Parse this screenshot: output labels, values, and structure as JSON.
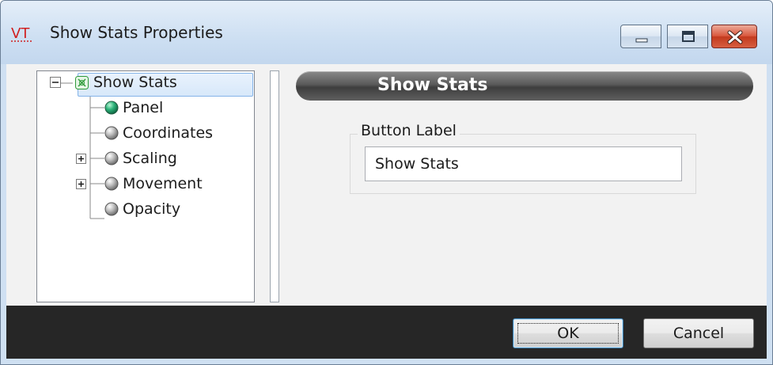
{
  "window": {
    "app_icon_text": "VT",
    "title": "Show Stats Properties"
  },
  "tree": {
    "root": {
      "label": "Show Stats",
      "expanded": true,
      "icon": "show-stats-icon"
    },
    "children": [
      {
        "label": "Panel",
        "icon": "green-sphere-icon",
        "expandable": false
      },
      {
        "label": "Coordinates",
        "icon": "gray-sphere-icon",
        "expandable": false
      },
      {
        "label": "Scaling",
        "icon": "gray-sphere-icon",
        "expandable": true
      },
      {
        "label": "Movement",
        "icon": "gray-sphere-icon",
        "expandable": true
      },
      {
        "label": "Opacity",
        "icon": "gray-sphere-icon",
        "expandable": false
      }
    ]
  },
  "panel": {
    "header_title": "Show Stats",
    "group_label": "Button Label",
    "button_label_value": "Show Stats"
  },
  "footer": {
    "ok_label": "OK",
    "cancel_label": "Cancel"
  },
  "colors": {
    "title_bar": "#cddff2",
    "footer": "#262626",
    "header_bar": "#4a4a4a",
    "selection": "#d7e8fa",
    "panel_sphere": "#2db37a",
    "close_button": "#c9452a"
  }
}
